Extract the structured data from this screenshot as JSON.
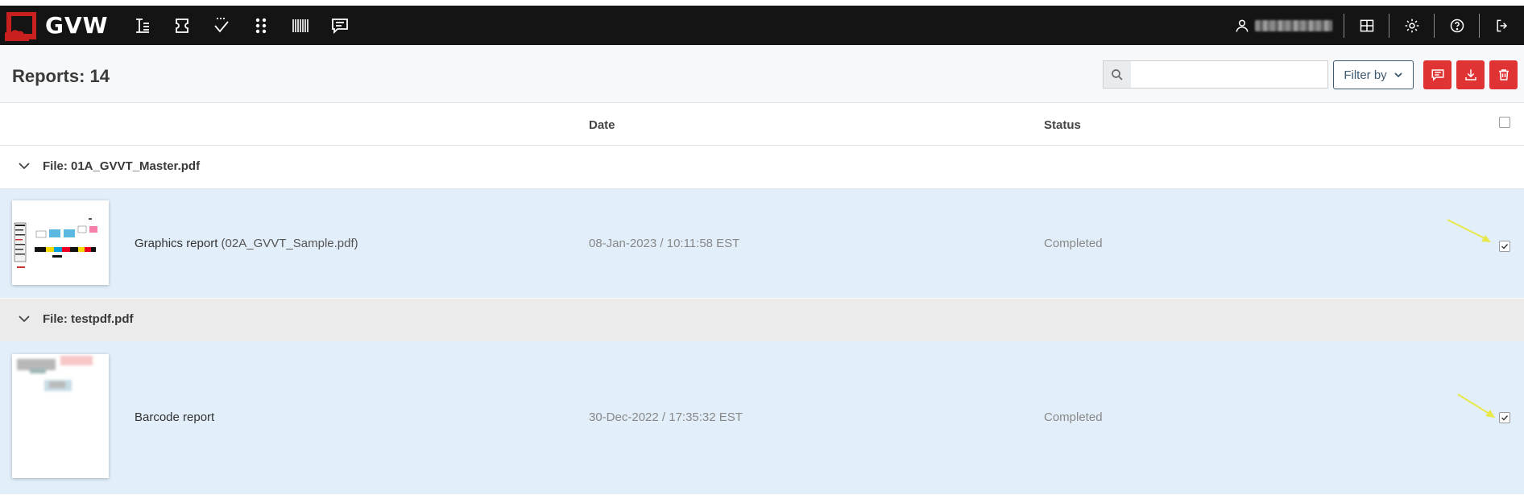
{
  "app": {
    "logo_text": "GVW",
    "nav_icons": [
      "text-align-icon",
      "ticket-icon",
      "spellcheck-icon",
      "dots-grid-icon",
      "barcode-icon",
      "comment-icon"
    ],
    "right_icons": [
      "layout-grid-icon",
      "gear-icon",
      "help-icon",
      "logout-icon"
    ]
  },
  "header": {
    "title": "Reports: 14",
    "search": {
      "value": "",
      "placeholder": ""
    },
    "filter_label": "Filter by",
    "actions": [
      "comment-icon",
      "download-icon",
      "trash-icon"
    ]
  },
  "columns": {
    "date": "Date",
    "status": "Status"
  },
  "groups": [
    {
      "label": "File: 01A_GVVT_Master.pdf",
      "report": {
        "name": "Graphics report",
        "file": "(02A_GVVT_Sample.pdf)",
        "date": "08-Jan-2023 / 10:11:58 EST",
        "status": "Completed",
        "checked": true
      }
    },
    {
      "label": "File: testpdf.pdf",
      "report": {
        "name": "Barcode report",
        "file": "",
        "date": "30-Dec-2022 / 17:35:32 EST",
        "status": "Completed",
        "checked": true
      }
    }
  ],
  "colors": {
    "accent_red": "#e03434",
    "selected_row": "#e2eef9",
    "topbar": "#141414",
    "annotation_arrow": "#e8e84a"
  }
}
